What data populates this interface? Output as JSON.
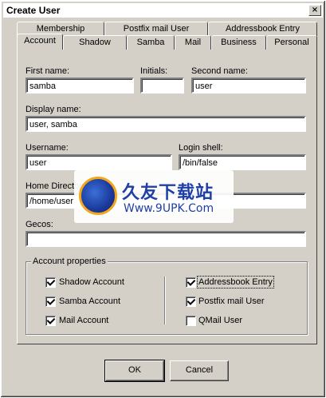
{
  "window": {
    "title": "Create User",
    "close_glyph": "×"
  },
  "tabs_back": [
    {
      "label": "Membership"
    },
    {
      "label": "Postfix mail User"
    },
    {
      "label": "Addressbook Entry"
    }
  ],
  "tabs_front": [
    {
      "label": "Account",
      "active": true
    },
    {
      "label": "Shadow"
    },
    {
      "label": "Samba"
    },
    {
      "label": "Mail"
    },
    {
      "label": "Business"
    },
    {
      "label": "Personal"
    }
  ],
  "form": {
    "first_name_label": "First name:",
    "first_name_value": "samba",
    "initials_label": "Initials:",
    "initials_value": "",
    "second_name_label": "Second name:",
    "second_name_value": "user",
    "display_name_label": "Display name:",
    "display_name_value": "user, samba",
    "username_label": "Username:",
    "username_value": "user",
    "login_shell_label": "Login shell:",
    "login_shell_value": "/bin/false",
    "home_dir_label": "Home Directory:",
    "home_dir_value": "/home/user",
    "gecos_label": "Gecos:",
    "gecos_value": ""
  },
  "account_properties": {
    "title": "Account properties",
    "left": [
      {
        "label": "Shadow Account",
        "checked": true
      },
      {
        "label": "Samba Account",
        "checked": true
      },
      {
        "label": "Mail Account",
        "checked": true
      }
    ],
    "right": [
      {
        "label": "Addressbook Entry",
        "checked": true
      },
      {
        "label": "Postfix mail User",
        "checked": true
      },
      {
        "label": "QMail User",
        "checked": false
      }
    ]
  },
  "buttons": {
    "ok": "OK",
    "cancel": "Cancel"
  },
  "watermark": {
    "title": "久友下载站",
    "url": "Www.9UPK.Com"
  },
  "icons": {
    "logo": "globe-logo-icon"
  }
}
